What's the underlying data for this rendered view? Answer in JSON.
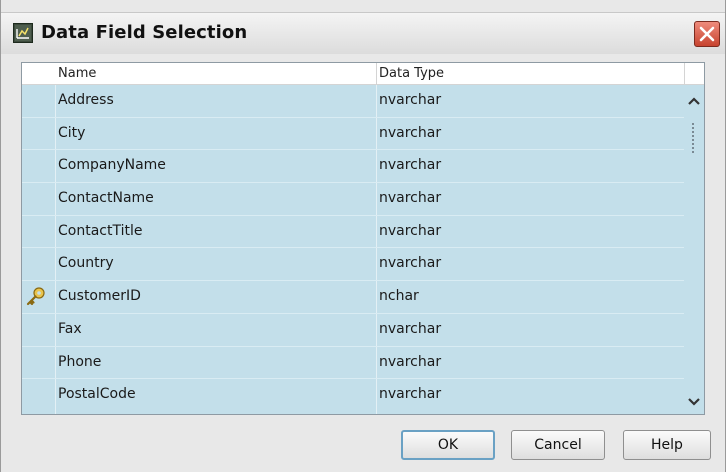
{
  "dialog": {
    "title": "Data Field Selection",
    "icons": {
      "app": "chart-app-icon",
      "close": "close-icon"
    }
  },
  "grid": {
    "columns": [
      "Name",
      "Data Type"
    ],
    "rows": [
      {
        "name": "Address",
        "type": "nvarchar",
        "key": false
      },
      {
        "name": "City",
        "type": "nvarchar",
        "key": false
      },
      {
        "name": "CompanyName",
        "type": "nvarchar",
        "key": false
      },
      {
        "name": "ContactName",
        "type": "nvarchar",
        "key": false
      },
      {
        "name": "ContactTitle",
        "type": "nvarchar",
        "key": false
      },
      {
        "name": "Country",
        "type": "nvarchar",
        "key": false
      },
      {
        "name": "CustomerID",
        "type": "nchar",
        "key": true
      },
      {
        "name": "Fax",
        "type": "nvarchar",
        "key": false
      },
      {
        "name": "Phone",
        "type": "nvarchar",
        "key": false
      },
      {
        "name": "PostalCode",
        "type": "nvarchar",
        "key": false
      }
    ],
    "row_background": "#c3dfea"
  },
  "buttons": {
    "ok": "OK",
    "cancel": "Cancel",
    "help": "Help"
  }
}
